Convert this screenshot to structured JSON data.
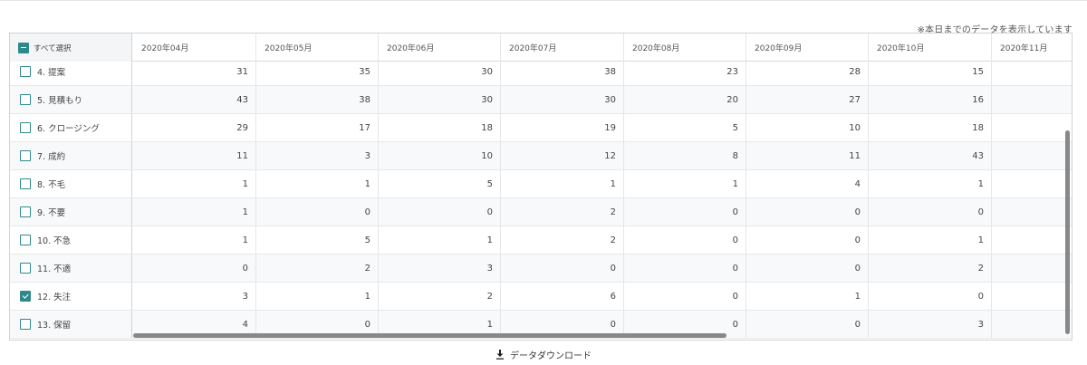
{
  "note": "※本日までのデータを表示しています",
  "table": {
    "select_all_label": "すべて選択",
    "months": [
      "2020年04月",
      "2020年05月",
      "2020年06月",
      "2020年07月",
      "2020年08月",
      "2020年09月",
      "2020年10月",
      "2020年11月"
    ],
    "rows": [
      {
        "label": "4. 提案",
        "checked": false,
        "values": [
          "31",
          "35",
          "30",
          "38",
          "23",
          "28",
          "15",
          ""
        ]
      },
      {
        "label": "5. 見積もり",
        "checked": false,
        "values": [
          "43",
          "38",
          "30",
          "30",
          "20",
          "27",
          "16",
          ""
        ]
      },
      {
        "label": "6. クロージング",
        "checked": false,
        "values": [
          "29",
          "17",
          "18",
          "19",
          "5",
          "10",
          "18",
          ""
        ]
      },
      {
        "label": "7. 成約",
        "checked": false,
        "values": [
          "11",
          "3",
          "10",
          "12",
          "8",
          "11",
          "43",
          ""
        ]
      },
      {
        "label": "8. 不毛",
        "checked": false,
        "values": [
          "1",
          "1",
          "5",
          "1",
          "1",
          "4",
          "1",
          ""
        ]
      },
      {
        "label": "9. 不要",
        "checked": false,
        "values": [
          "1",
          "0",
          "0",
          "2",
          "0",
          "0",
          "0",
          ""
        ]
      },
      {
        "label": "10. 不急",
        "checked": false,
        "values": [
          "1",
          "5",
          "1",
          "2",
          "0",
          "0",
          "1",
          ""
        ]
      },
      {
        "label": "11. 不適",
        "checked": false,
        "values": [
          "0",
          "2",
          "3",
          "0",
          "0",
          "0",
          "2",
          ""
        ]
      },
      {
        "label": "12. 失注",
        "checked": true,
        "values": [
          "3",
          "1",
          "2",
          "6",
          "0",
          "1",
          "0",
          ""
        ]
      },
      {
        "label": "13. 保留",
        "checked": false,
        "values": [
          "4",
          "0",
          "1",
          "0",
          "0",
          "0",
          "3",
          ""
        ]
      }
    ]
  },
  "download": {
    "label": "データダウンロード",
    "icon": "download-icon"
  },
  "colors": {
    "accent": "#2e8a8a",
    "border": "#cfd3d6",
    "scrollbar": "#888888"
  }
}
